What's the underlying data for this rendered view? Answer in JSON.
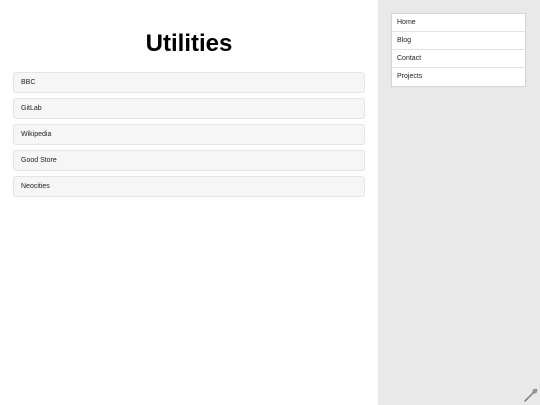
{
  "main": {
    "title": "Utilities",
    "links": [
      "BBC",
      "GitLab",
      "Wikipedia",
      "Good Store",
      "Neocities"
    ]
  },
  "sidebar": {
    "nav_items": [
      "Home",
      "Blog",
      "Contact",
      "Projects"
    ]
  },
  "icons": {
    "corner_tool": "wrench-icon"
  },
  "colors": {
    "sidebar_bg": "#e9e9e9",
    "link_bg": "#f6f6f6"
  }
}
